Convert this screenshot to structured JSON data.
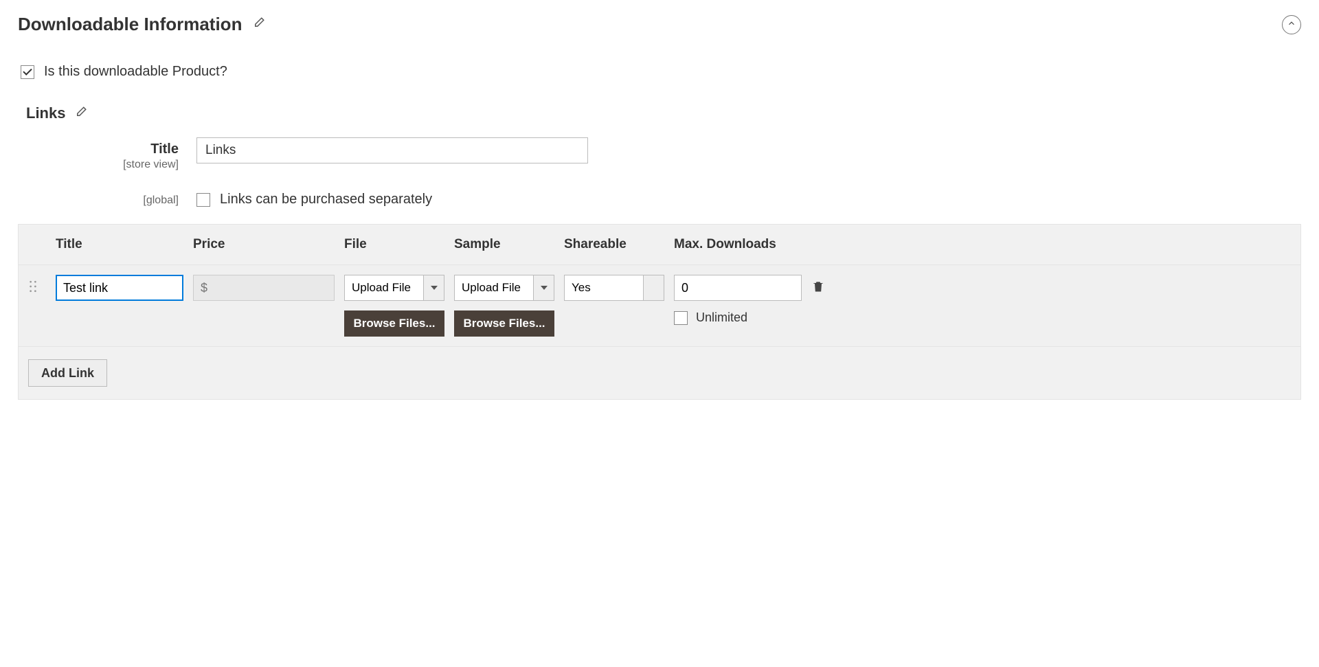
{
  "section": {
    "title": "Downloadable Information"
  },
  "is_downloadable": {
    "label": "Is this downloadable Product?",
    "checked": true
  },
  "links": {
    "header": "Links",
    "title_label": "Title",
    "title_scope": "[store view]",
    "title_value": "Links",
    "separate_scope": "[global]",
    "separate_label": "Links can be purchased separately",
    "separate_checked": false,
    "columns": {
      "title": "Title",
      "price": "Price",
      "file": "File",
      "sample": "Sample",
      "shareable": "Shareable",
      "max_downloads": "Max. Downloads"
    },
    "row": {
      "title": "Test link",
      "price_prefix": "$",
      "price": "",
      "file_btn": "Upload File",
      "file_browse": "Browse Files...",
      "sample_btn": "Upload File",
      "sample_browse": "Browse Files...",
      "shareable": "Yes",
      "max_downloads": "0",
      "unlimited_label": "Unlimited",
      "unlimited_checked": false
    },
    "add_link": "Add Link"
  }
}
